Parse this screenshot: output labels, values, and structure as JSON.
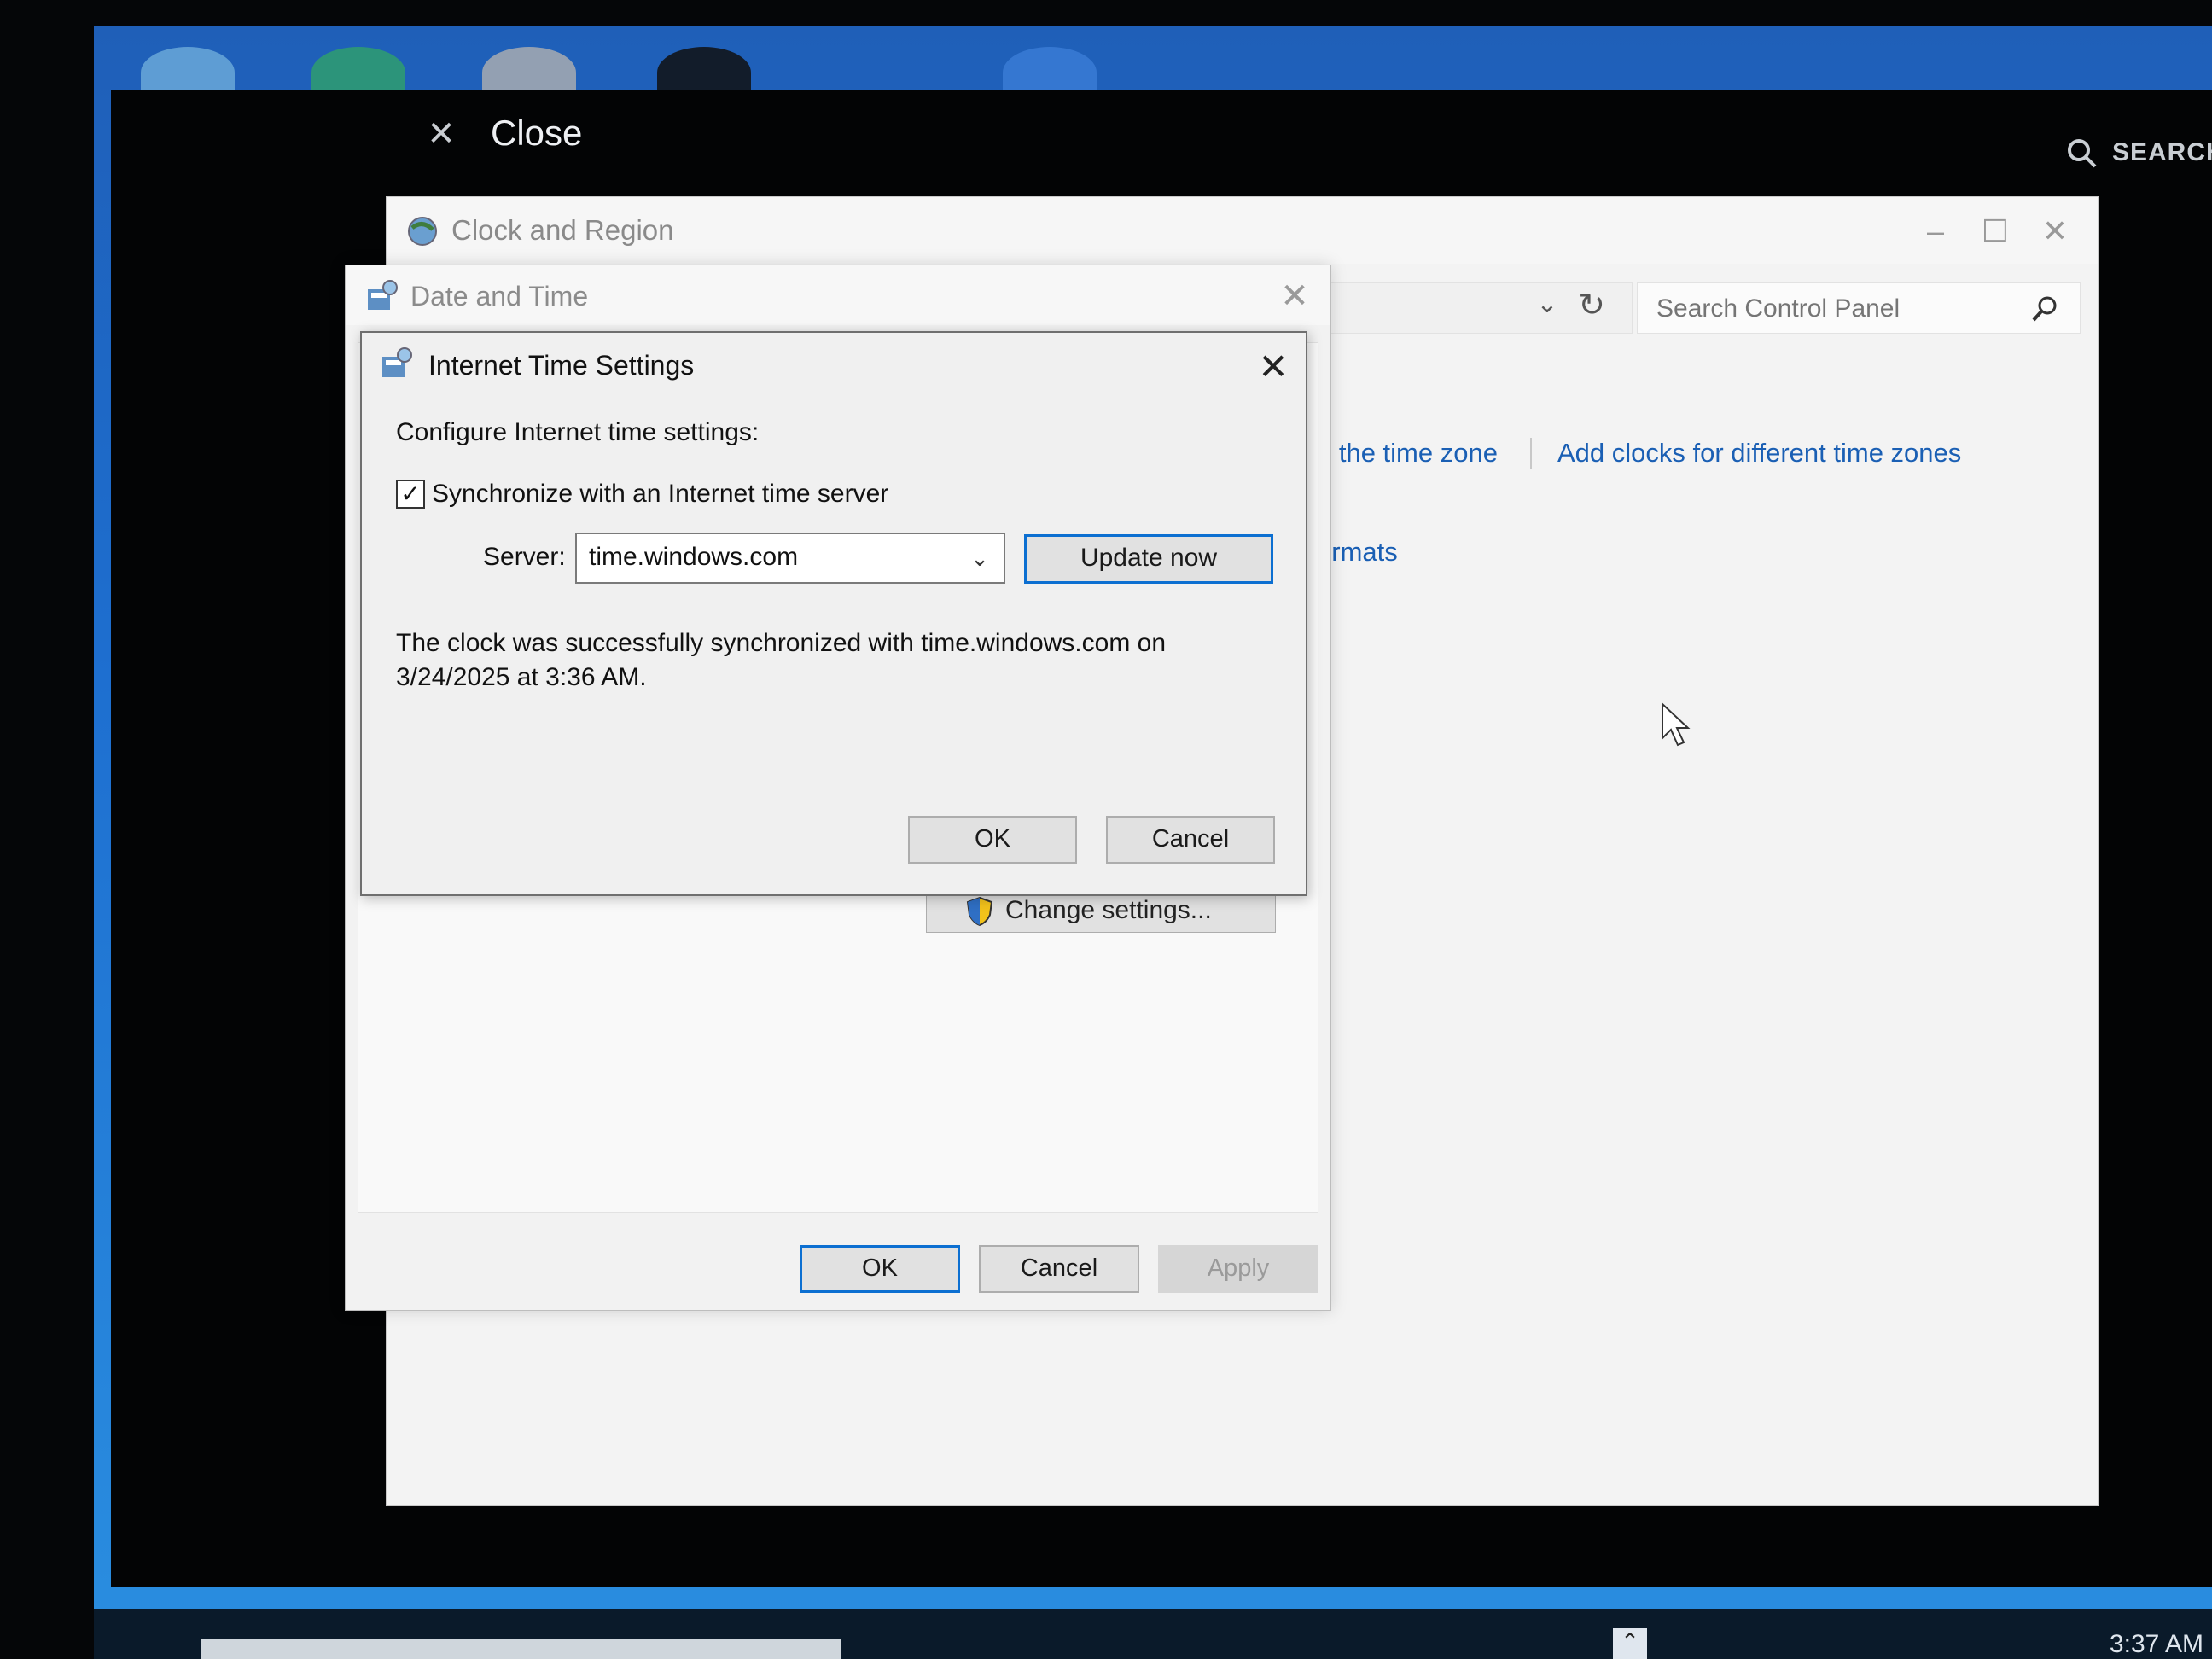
{
  "overlay": {
    "close_label": "Close",
    "search_label": "SEARCH"
  },
  "control_panel": {
    "title": "Clock and Region",
    "search_placeholder": "Search Control Panel",
    "link_timezone": "e the time zone",
    "link_add_clocks": "Add clocks for different time zones",
    "link_formats": "ormats"
  },
  "date_time_dialog": {
    "title": "Date and Time",
    "change_settings_label": "Change settings...",
    "ok_label": "OK",
    "cancel_label": "Cancel",
    "apply_label": "Apply"
  },
  "internet_time_dialog": {
    "title": "Internet Time Settings",
    "heading": "Configure Internet time settings:",
    "sync_label": "Synchronize with an Internet time server",
    "sync_checked": true,
    "server_label": "Server:",
    "server_value": "time.windows.com",
    "update_now_label": "Update now",
    "status_line1": "The clock was successfully synchronized with time.windows.com on",
    "status_line2": "3/24/2025 at 3:36 AM.",
    "ok_label": "OK",
    "cancel_label": "Cancel"
  },
  "taskbar": {
    "clock": "3:37 AM"
  },
  "colors": {
    "accent": "#0c6fd1",
    "link": "#1a5fb4",
    "overlay_bg": "#030405"
  }
}
